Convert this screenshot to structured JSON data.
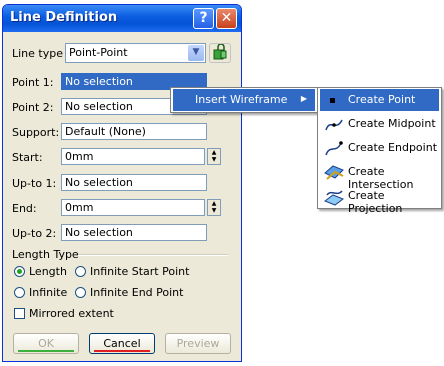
{
  "dialog": {
    "title": "Line Definition",
    "help_glyph": "?",
    "close_glyph": "✕",
    "line_type_label": "Line type :",
    "line_type_value": "Point-Point",
    "fields": [
      {
        "label": "Point 1:",
        "value": "No selection",
        "state": "selected"
      },
      {
        "label": "Point 2:",
        "value": "No selection"
      },
      {
        "label": "Support:",
        "value": "Default (None)"
      },
      {
        "label": "Start:",
        "value": "0mm"
      },
      {
        "label": "Up-to 1:",
        "value": "No selection"
      },
      {
        "label": "End:",
        "value": "0mm"
      },
      {
        "label": "Up-to 2:",
        "value": "No selection"
      }
    ],
    "length_type_label": "Length Type",
    "length_options": [
      {
        "label": "Length",
        "selected": true
      },
      {
        "label": "Infinite Start Point",
        "selected": false
      },
      {
        "label": "Infinite",
        "selected": false
      },
      {
        "label": "Infinite End Point",
        "selected": false
      }
    ],
    "mirrored_label": "Mirrored extent",
    "mirrored_checked": false,
    "buttons": {
      "ok": "OK",
      "cancel": "Cancel",
      "preview": "Preview"
    }
  },
  "context_menu": {
    "item": "Insert Wireframe",
    "arrow": "▶"
  },
  "submenu": {
    "items": [
      {
        "label": "Create Point",
        "icon": "point-icon",
        "highlighted": true
      },
      {
        "label": "Create Midpoint",
        "icon": "midpoint-icon"
      },
      {
        "label": "Create Endpoint",
        "icon": "endpoint-icon"
      },
      {
        "label": "Create Intersection",
        "icon": "intersection-icon"
      },
      {
        "label": "Create Projection",
        "icon": "projection-icon"
      }
    ]
  },
  "colors": {
    "selection": "#316ac5",
    "titlebar": "#0553d6",
    "dialog_bg": "#ece9d8"
  }
}
